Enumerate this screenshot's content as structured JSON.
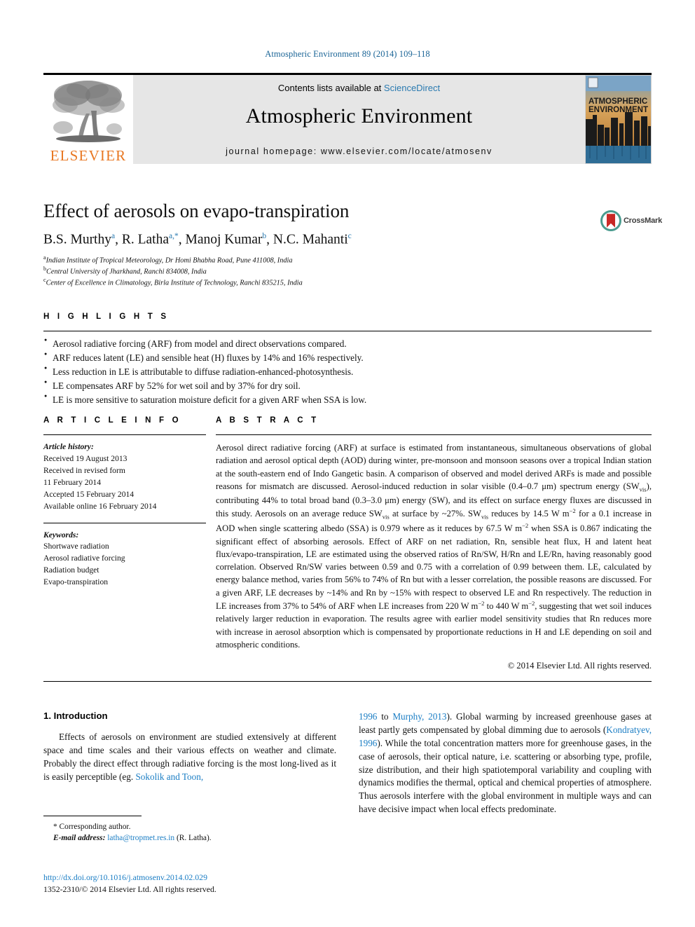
{
  "running_head": "Atmospheric Environment 89 (2014) 109–118",
  "masthead": {
    "contents_prefix": "Contents lists available at",
    "sciencedirect": "ScienceDirect",
    "journal_name": "Atmospheric Environment",
    "homepage": "journal homepage: www.elsevier.com/locate/atmosenv",
    "publisher_wordmark": "ELSEVIER",
    "cover_title_line1": "ATMOSPHERIC",
    "cover_title_line2": "ENVIRONMENT",
    "accent_orange": "#e87722",
    "link_blue": "#2a7ab0"
  },
  "crossmark": {
    "label": "CrossMark"
  },
  "article": {
    "title": "Effect of aerosols on evapo-transpiration",
    "authors": [
      {
        "name": "B.S. Murthy",
        "marks": "a"
      },
      {
        "name": "R. Latha",
        "marks": "a,*"
      },
      {
        "name": "Manoj Kumar",
        "marks": "b"
      },
      {
        "name": "N.C. Mahanti",
        "marks": "c"
      }
    ],
    "affiliations": [
      {
        "mark": "a",
        "text": "Indian Institute of Tropical Meteorology, Dr Homi Bhabha Road, Pune 411008, India"
      },
      {
        "mark": "b",
        "text": "Central University of Jharkhand, Ranchi 834008, India"
      },
      {
        "mark": "c",
        "text": "Center of Excellence in Climatology, Birla Institute of Technology, Ranchi 835215, India"
      }
    ]
  },
  "highlights": {
    "label": "H I G H L I G H T S",
    "items": [
      "Aerosol radiative forcing (ARF) from model and direct observations compared.",
      "ARF reduces latent (LE) and sensible heat (H) fluxes by 14% and 16% respectively.",
      "Less reduction in LE is attributable to diffuse radiation-enhanced-photosynthesis.",
      "LE compensates ARF by 52% for wet soil and by 37% for dry soil.",
      "LE is more sensitive to saturation moisture deficit for a given ARF when SSA is low."
    ]
  },
  "article_info": {
    "label": "A R T I C L E   I N F O",
    "history_label": "Article history:",
    "history_lines": [
      "Received 19 August 2013",
      "Received in revised form",
      "11 February 2014",
      "Accepted 15 February 2014",
      "Available online 16 February 2014"
    ],
    "keywords_label": "Keywords:",
    "keywords": [
      "Shortwave radiation",
      "Aerosol radiative forcing",
      "Radiation budget",
      "Evapo-transpiration"
    ]
  },
  "abstract": {
    "label": "A B S T R A C T",
    "paragraph_1": "Aerosol direct radiative forcing (ARF) at surface is estimated from instantaneous, simultaneous observations of global radiation and aerosol optical depth (AOD) during winter, pre-monsoon and monsoon seasons over a tropical Indian station at the south-eastern end of Indo Gangetic basin. A comparison of observed and model derived ARFs is made and possible reasons for mismatch are discussed. Aerosol-induced reduction in solar visible (0.4–0.7 μm) spectrum energy (SW",
    "sub_vis_1": "vis",
    "paragraph_2": "), contributing 44% to total broad band (0.3–3.0 μm) energy (SW), and its effect on surface energy fluxes are discussed in this study. Aerosols on an average reduce SW",
    "sub_vis_2": "vis",
    "paragraph_3": " at surface by ~27%. SW",
    "sub_vis_3": "vis",
    "paragraph_4": " reduces by 14.5 W m",
    "sup_1": "−2",
    "paragraph_5": " for a 0.1 increase in AOD when single scattering albedo (SSA) is 0.979 where as it reduces by 67.5 W m",
    "sup_2": "−2",
    "paragraph_6": " when SSA is 0.867 indicating the significant effect of absorbing aerosols. Effect of ARF on net radiation, Rn, sensible heat flux, H and latent heat flux/evapo-transpiration, LE are estimated using the observed ratios of Rn/SW, H/Rn and LE/Rn, having reasonably good correlation. Observed Rn/SW varies between 0.59 and 0.75 with a correlation of 0.99 between them. LE, calculated by energy balance method, varies from 56% to 74% of Rn but with a lesser correlation, the possible reasons are discussed. For a given ARF, LE decreases by ~14% and Rn by ~15% with respect to observed LE and Rn respectively. The reduction in LE increases from 37% to 54% of ARF when LE increases from 220 W m",
    "sup_3": "−2",
    "paragraph_7": " to 440 W m",
    "sup_4": "−2",
    "paragraph_8": ", suggesting that wet soil induces relatively larger reduction in evaporation. The results agree with earlier model sensitivity studies that Rn reduces more with increase in aerosol absorption which is compensated by proportionate reductions in H and LE depending on soil and atmospheric conditions.",
    "copyright": "© 2014 Elsevier Ltd. All rights reserved."
  },
  "introduction": {
    "heading": "1. Introduction",
    "left_text_1": "Effects of aerosols on environment are studied extensively at different space and time scales and their various effects on weather and climate. Probably the direct effect through radiative forcing is the most long-lived as it is easily perceptible (eg. ",
    "left_link_1": "Sokolik and Toon,",
    "right_link_1": "1996",
    "right_text_1": " to ",
    "right_link_2": "Murphy, 2013",
    "right_text_2": "). Global warming by increased greenhouse gases at least partly gets compensated by global dimming due to aerosols (",
    "right_link_3": "Kondratyev, 1996",
    "right_text_3": "). While the total concentration matters more for greenhouse gases, in the case of aerosols, their optical nature, i.e. scattering or absorbing type, profile, size distribution, and their high spatiotemporal variability and coupling with dynamics modifies the thermal, optical and chemical properties of atmosphere. Thus aerosols interfere with the global environment in multiple ways and can have decisive impact when local effects predominate."
  },
  "footnotes": {
    "corresponding": "* Corresponding author.",
    "email_label": "E-mail address:",
    "email": "latha@tropmet.res.in",
    "email_suffix": " (R. Latha).",
    "doi": "http://dx.doi.org/10.1016/j.atmosenv.2014.02.029",
    "issn_line": "1352-2310/© 2014 Elsevier Ltd. All rights reserved."
  }
}
